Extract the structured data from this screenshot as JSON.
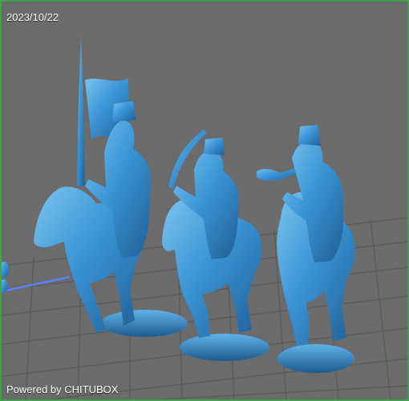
{
  "viewport": {
    "date_stamp": "2023/10/22",
    "watermark": "Powered by CHITUBOX",
    "subject": "three-cavalry-miniatures",
    "colors": {
      "background": "#6b6b6b",
      "grid": "#5b5b5b",
      "model": "#3b95d6",
      "model_shadow": "#1f5f96",
      "model_highlight": "#7cc4f0",
      "frame": "#3fa34a",
      "axis_line": "#5a82ff"
    }
  }
}
